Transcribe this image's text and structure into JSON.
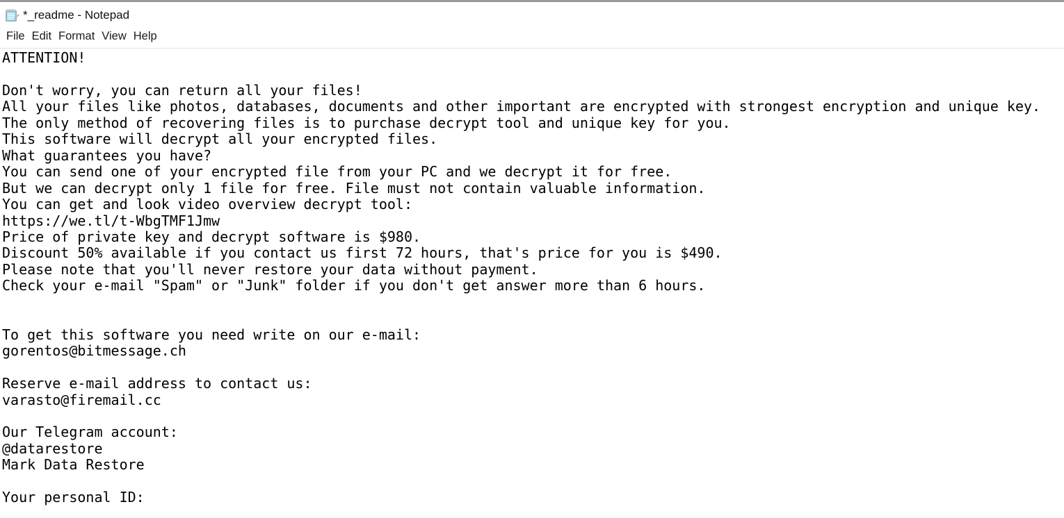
{
  "window": {
    "title": "*_readme - Notepad",
    "icon": "notepad-icon"
  },
  "menubar": {
    "items": [
      {
        "label": "File"
      },
      {
        "label": "Edit"
      },
      {
        "label": "Format"
      },
      {
        "label": "View"
      },
      {
        "label": "Help"
      }
    ]
  },
  "editor": {
    "content": "ATTENTION!\n\nDon't worry, you can return all your files!\nAll your files like photos, databases, documents and other important are encrypted with strongest encryption and unique key.\nThe only method of recovering files is to purchase decrypt tool and unique key for you.\nThis software will decrypt all your encrypted files.\nWhat guarantees you have?\nYou can send one of your encrypted file from your PC and we decrypt it for free.\nBut we can decrypt only 1 file for free. File must not contain valuable information.\nYou can get and look video overview decrypt tool:\nhttps://we.tl/t-WbgTMF1Jmw\nPrice of private key and decrypt software is $980.\nDiscount 50% available if you contact us first 72 hours, that's price for you is $490.\nPlease note that you'll never restore your data without payment.\nCheck your e-mail \"Spam\" or \"Junk\" folder if you don't get answer more than 6 hours.\n\n\nTo get this software you need write on our e-mail:\ngorentos@bitmessage.ch\n\nReserve e-mail address to contact us:\nvarasto@firemail.cc\n\nOur Telegram account:\n@datarestore\nMark Data Restore\n\nYour personal ID:",
    "lines": [
      "ATTENTION!",
      "",
      "Don't worry, you can return all your files!",
      "All your files like photos, databases, documents and other important are encrypted with strongest encryption and unique key.",
      "The only method of recovering files is to purchase decrypt tool and unique key for you.",
      "This software will decrypt all your encrypted files.",
      "What guarantees you have?",
      "You can send one of your encrypted file from your PC and we decrypt it for free.",
      "But we can decrypt only 1 file for free. File must not contain valuable information.",
      "You can get and look video overview decrypt tool:",
      "https://we.tl/t-WbgTMF1Jmw",
      "Price of private key and decrypt software is $980.",
      "Discount 50% available if you contact us first 72 hours, that's price for you is $490.",
      "Please note that you'll never restore your data without payment.",
      "Check your e-mail \"Spam\" or \"Junk\" folder if you don't get answer more than 6 hours.",
      "",
      "",
      "To get this software you need write on our e-mail:",
      "gorentos@bitmessage.ch",
      "",
      "Reserve e-mail address to contact us:",
      "varasto@firemail.cc",
      "",
      "Our Telegram account:",
      "@datarestore",
      "Mark Data Restore",
      "",
      "Your personal ID:"
    ],
    "details": {
      "price_full": "$980",
      "price_discount": "$490",
      "discount_percent": "50%",
      "discount_window_hours": "72",
      "answer_window_hours": "6",
      "free_decrypt_file_count": "1",
      "video_url": "https://we.tl/t-WbgTMF1Jmw",
      "primary_email": "gorentos@bitmessage.ch",
      "reserve_email": "varasto@firemail.cc",
      "telegram_handle": "@datarestore",
      "telegram_name": "Mark Data Restore"
    }
  },
  "colors": {
    "background": "#ffffff",
    "text": "#000000",
    "title_text": "#111111",
    "menu_text": "#1a1a1a",
    "top_border": "#9a9a9a",
    "menu_separator": "#e3e3e3",
    "icon_blue": "#aad8ea",
    "icon_outline": "#7fa8bd"
  }
}
